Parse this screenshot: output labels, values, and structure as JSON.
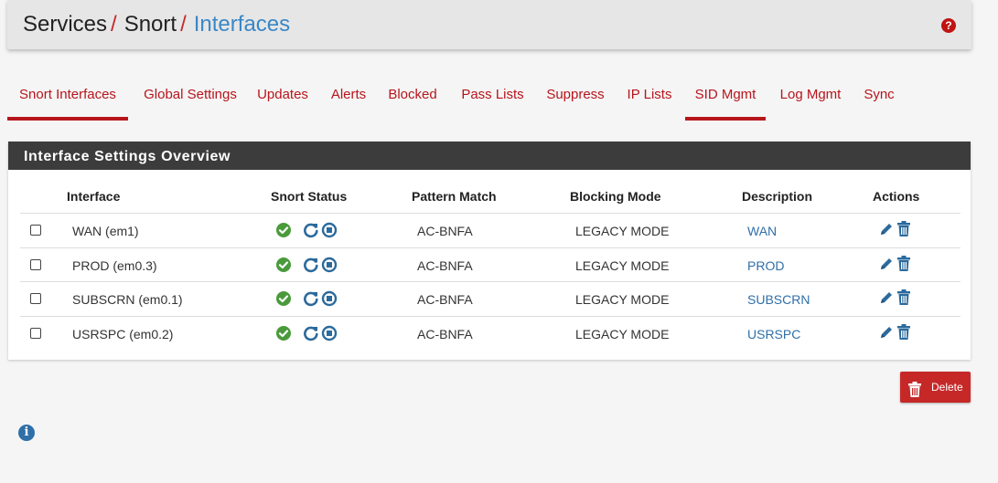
{
  "breadcrumb": {
    "items": [
      "Services",
      "Snort",
      "Interfaces"
    ],
    "separator": "/"
  },
  "help_icon": "question-circle-icon",
  "tabs": [
    {
      "label": "Snort Interfaces",
      "active": true
    },
    {
      "label": "Global Settings",
      "active": false
    },
    {
      "label": "Updates",
      "active": false
    },
    {
      "label": "Alerts",
      "active": false
    },
    {
      "label": "Blocked",
      "active": false
    },
    {
      "label": "Pass Lists",
      "active": false
    },
    {
      "label": "Suppress",
      "active": false
    },
    {
      "label": "IP Lists",
      "active": false
    },
    {
      "label": "SID Mgmt",
      "active": true
    },
    {
      "label": "Log Mgmt",
      "active": false
    },
    {
      "label": "Sync",
      "active": false
    }
  ],
  "panel": {
    "title": "Interface Settings Overview",
    "columns": [
      "Interface",
      "Snort Status",
      "Pattern Match",
      "Blocking Mode",
      "Description",
      "Actions"
    ],
    "rows": [
      {
        "interface": "WAN (em1)",
        "pattern_match": "AC-BNFA",
        "blocking_mode": "LEGACY MODE",
        "description": "WAN"
      },
      {
        "interface": "PROD (em0.3)",
        "pattern_match": "AC-BNFA",
        "blocking_mode": "LEGACY MODE",
        "description": "PROD"
      },
      {
        "interface": "SUBSCRN (em0.1)",
        "pattern_match": "AC-BNFA",
        "blocking_mode": "LEGACY MODE",
        "description": "SUBSCRN"
      },
      {
        "interface": "USRSPC (em0.2)",
        "pattern_match": "AC-BNFA",
        "blocking_mode": "LEGACY MODE",
        "description": "USRSPC"
      }
    ]
  },
  "delete_button": {
    "label": "Delete",
    "icon": "trash-icon"
  },
  "info_icon": "info-circle-icon",
  "colors": {
    "brand_red": "#b7151c",
    "link_blue": "#2f6fa8",
    "status_green": "#4a9a3c",
    "panel_header": "#3c3c3c"
  }
}
